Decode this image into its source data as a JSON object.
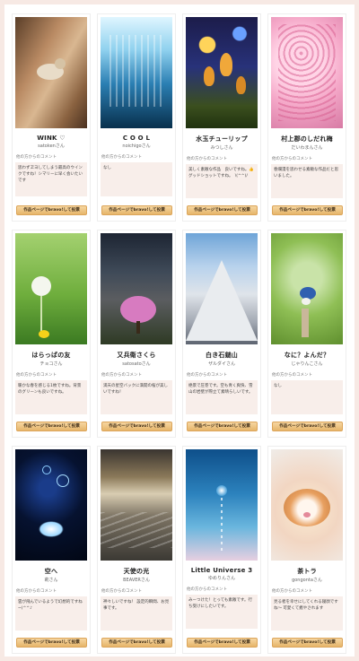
{
  "cards": [
    {
      "title": "WINK ♡",
      "author": "satokenさん",
      "comment_label": "他の方からのコメント",
      "comment": "思わずヱヨしてしまう最高のウインクですね！シマリーに早く会いたいです",
      "button": "作品ページでbravo!して投票"
    },
    {
      "title": "C O O L",
      "author": "noichigoさん",
      "comment_label": "他の方からのコメント",
      "comment": "なし",
      "button": "作品ページでbravo!して投票"
    },
    {
      "title": "水玉チューリップ",
      "author": "みつしさん",
      "comment_label": "他の方からのコメント",
      "comment": "美しく素敵な作品　良いですね。👍グッドショットですね。　\\(^^)/",
      "button": "作品ページでbravo!して投票"
    },
    {
      "title": "村上郡のしだれ梅",
      "author": "だいわまんさん",
      "comment_label": "他の方からのコメント",
      "comment": "春爛漫を思わせる素敵な作品だと思いました。",
      "button": "作品ページでbravo!して投票"
    },
    {
      "title": "はらっぱの友",
      "author": "チョコさん",
      "comment_label": "他の方からのコメント",
      "comment": "暖かな春を感じる1枚ですね。背景のグリーンも良いですね。",
      "button": "作品ページでbravo!して投票"
    },
    {
      "title": "又兵衛さくら",
      "author": "satosatoさん",
      "comment_label": "他の方からのコメント",
      "comment": "満天の星空バックに満開の桜が美しいですね！",
      "button": "作品ページでbravo!して投票"
    },
    {
      "title": "白き石鎚山",
      "author": "ザルダイさん",
      "comment_label": "他の方からのコメント",
      "comment": "絶景で圧巻です。空も青く爽快、雪山の岩壁が際立て素晴らしいです。",
      "button": "作品ページでbravo!して投票"
    },
    {
      "title": "なに？よんだ？",
      "author": "じゃりんこさん",
      "comment_label": "他の方からのコメント",
      "comment": "なし",
      "button": "作品ページでbravo!して投票"
    },
    {
      "title": "空へ",
      "author": "莉さん",
      "comment_label": "他の方からのコメント",
      "comment": "雲が飛んでいるようで幻想的ですね~(^^♪",
      "button": "作品ページでbravo!して投票"
    },
    {
      "title": "天使の光",
      "author": "BEAVERさん",
      "comment_label": "他の方からのコメント",
      "comment": "神々しいですね！ 設定的瞬間、お見事です。",
      "button": "作品ページでbravo!して投票"
    },
    {
      "title": "Little Universe 3",
      "author": "ゆめりんさん",
      "comment_label": "他の方からのコメント",
      "comment": "みーつけた！とっても素敵です。行ち受けにしたいです。",
      "button": "作品ページでbravo!して投票"
    },
    {
      "title": "茶トラ",
      "author": "gongontaさん",
      "comment_label": "他の方からのコメント",
      "comment": "見る者を幸せにしてくれる寝顔ですね～ 可愛くて癒やされます",
      "button": "作品ページでbravo!して投票"
    }
  ]
}
